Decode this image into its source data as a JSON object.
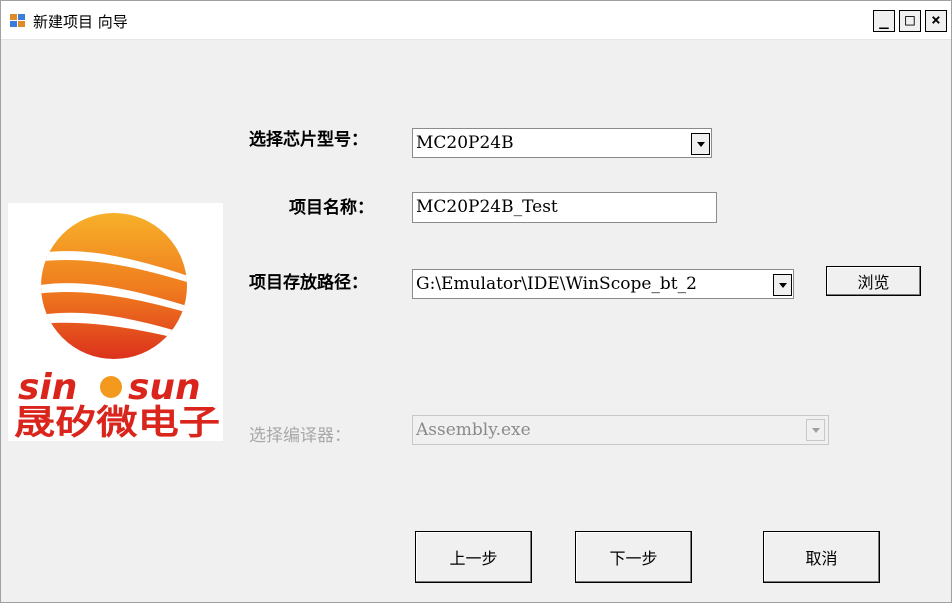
{
  "window": {
    "title": "新建项目 向导",
    "controls": {
      "minimize": "_",
      "maximize": "□",
      "close": "×"
    }
  },
  "logo": {
    "brand_text": "sin",
    "brand_text_2": "sun",
    "brand_chinese": "晟矽微电子",
    "colors": {
      "red": "#d9251c",
      "orange": "#f39a1e"
    }
  },
  "form": {
    "chip_model": {
      "label": "选择芯片型号：",
      "value": "MC20P24B"
    },
    "project_name": {
      "label": "项目名称：",
      "value": "MC20P24B_Test"
    },
    "project_path": {
      "label": "项目存放路径：",
      "value": "G:\\Emulator\\IDE\\WinScope_bt_2",
      "browse_label": "浏览"
    },
    "compiler": {
      "label": "选择编译器：",
      "value": "Assembly.exe",
      "enabled": false
    }
  },
  "footer": {
    "prev_label": "上一步",
    "next_label": "下一步",
    "cancel_label": "取消"
  }
}
